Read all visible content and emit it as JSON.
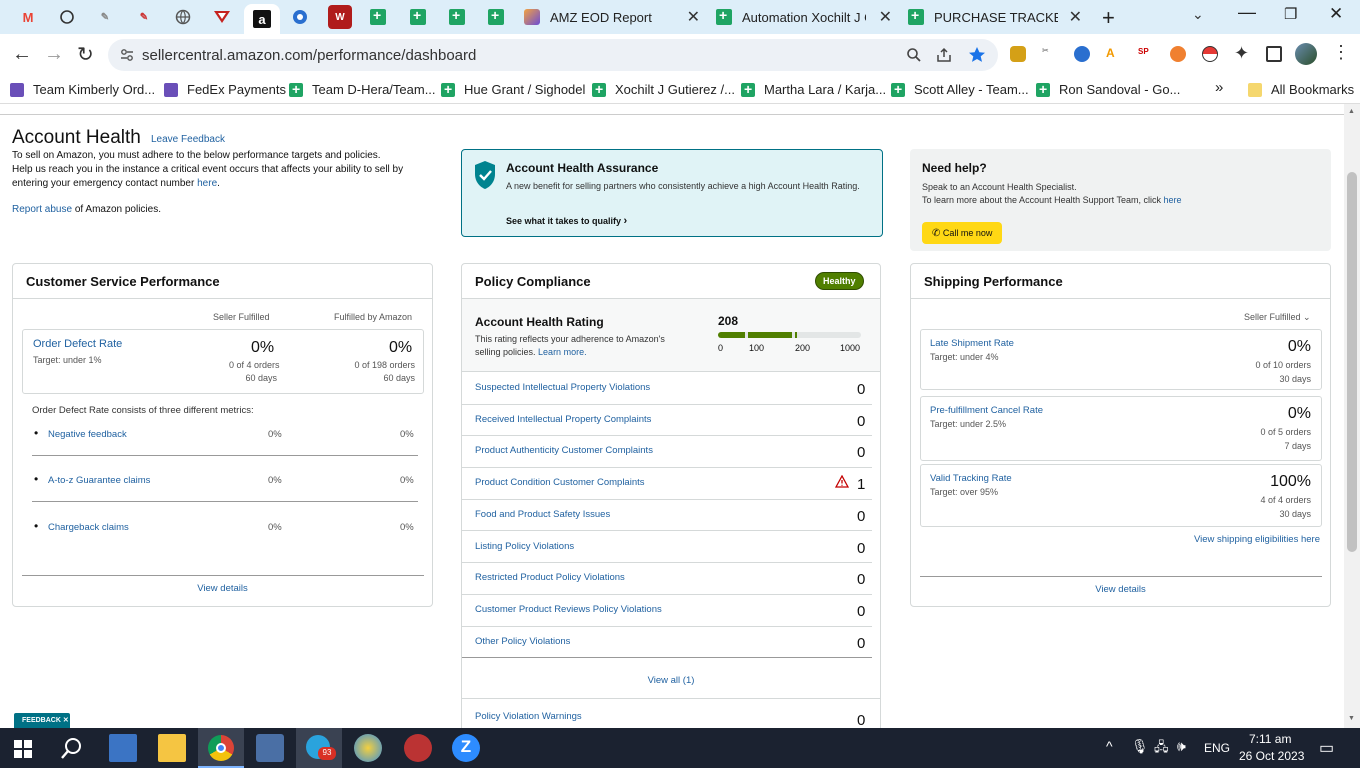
{
  "browser": {
    "tabs": [
      {
        "title": "AMZ EOD Report"
      },
      {
        "title": "Automation Xochilt J G"
      },
      {
        "title": "PURCHASE TRACKER JU"
      }
    ],
    "url": "sellercentral.amazon.com/performance/dashboard",
    "bookmarks": [
      "Team Kimberly Ord...",
      "FedEx Payments",
      "Team D-Hera/Team...",
      "Hue Grant / Sighodel",
      "Xochilt J Gutierez /...",
      "Martha Lara / Karja...",
      "Scott Alley - Team...",
      "Ron Sandoval - Go...",
      "All Bookmarks"
    ]
  },
  "header": {
    "title": "Account Health",
    "feedback": "Leave Feedback",
    "intro1": "To sell on Amazon, you must adhere to the below performance targets and policies.",
    "intro2": "Help us reach you in the instance a critical event occurs that affects your ability to sell by entering your emergency contact number",
    "intro2_link": "here",
    "report_link": "Report abuse",
    "report_rest": "of Amazon policies."
  },
  "assurance": {
    "title": "Account Health Assurance",
    "desc": "A new benefit for selling partners who consistently achieve a high Account Health Rating.",
    "link": "See what it takes to qualify"
  },
  "help": {
    "title": "Need help?",
    "line1": "Speak to an Account Health Specialist.",
    "line2": "To learn more about the Account Health Support Team, click",
    "line2_link": "here",
    "button": "Call me now"
  },
  "csp": {
    "title": "Customer Service Performance",
    "col1": "Seller Fulfilled",
    "col2": "Fulfilled by Amazon",
    "odr_label": "Order Defect Rate",
    "odr_target": "Target: under 1%",
    "sf_value": "0%",
    "sf_orders": "0 of 4 orders",
    "sf_days": "60 days",
    "fba_value": "0%",
    "fba_orders": "0 of 198 orders",
    "fba_days": "60 days",
    "metrics_intro": "Order Defect Rate consists of three different metrics:",
    "metrics": [
      {
        "label": "Negative feedback",
        "sf": "0%",
        "fba": "0%"
      },
      {
        "label": "A-to-z Guarantee claims",
        "sf": "0%",
        "fba": "0%"
      },
      {
        "label": "Chargeback claims",
        "sf": "0%",
        "fba": "0%"
      }
    ],
    "view": "View details"
  },
  "policy": {
    "title": "Policy Compliance",
    "badge": "Healthy",
    "ahr_title": "Account Health Rating",
    "ahr_desc": "This rating reflects your adherence to Amazon's selling policies.",
    "ahr_learn": "Learn more.",
    "ahr_value": "208",
    "scale": [
      "0",
      "100",
      "200",
      "1000"
    ],
    "items": [
      {
        "label": "Suspected Intellectual Property Violations",
        "count": "0"
      },
      {
        "label": "Received Intellectual Property Complaints",
        "count": "0"
      },
      {
        "label": "Product Authenticity Customer Complaints",
        "count": "0"
      },
      {
        "label": "Product Condition Customer Complaints",
        "count": "1"
      },
      {
        "label": "Food and Product Safety Issues",
        "count": "0"
      },
      {
        "label": "Listing Policy Violations",
        "count": "0"
      },
      {
        "label": "Restricted Product Policy Violations",
        "count": "0"
      },
      {
        "label": "Customer Product Reviews Policy Violations",
        "count": "0"
      },
      {
        "label": "Other Policy Violations",
        "count": "0"
      }
    ],
    "view_all": "View all (1)",
    "warnings_label": "Policy Violation Warnings",
    "warnings_count": "0"
  },
  "shipping": {
    "title": "Shipping Performance",
    "filter": "Seller Fulfilled",
    "metrics": [
      {
        "label": "Late Shipment Rate",
        "target": "Target: under 4%",
        "value": "0%",
        "orders": "0 of 10 orders",
        "days": "30 days"
      },
      {
        "label": "Pre-fulfillment Cancel Rate",
        "target": "Target: under 2.5%",
        "value": "0%",
        "orders": "0 of 5 orders",
        "days": "7 days"
      },
      {
        "label": "Valid Tracking Rate",
        "target": "Target: over 95%",
        "value": "100%",
        "orders": "4 of 4 orders",
        "days": "30 days"
      }
    ],
    "eligibility": "View shipping eligibilities here",
    "view": "View details"
  },
  "feedback_tab": "FEEDBACK",
  "taskbar": {
    "lang": "ENG",
    "time": "7:11 am",
    "date": "26 Oct 2023",
    "badge": "93"
  }
}
